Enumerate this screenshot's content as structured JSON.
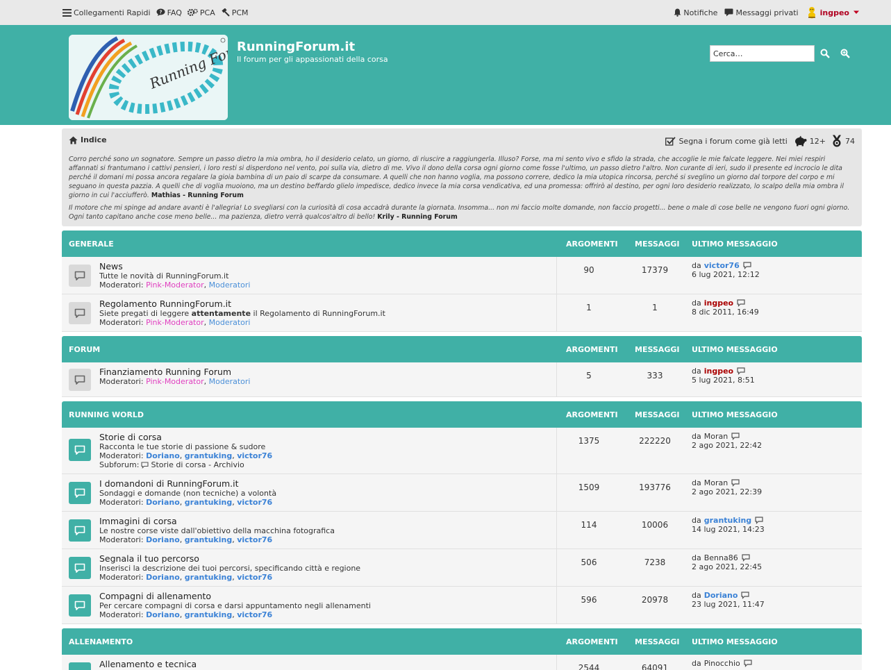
{
  "topbar": {
    "quick_links": "Collegamenti Rapidi",
    "faq": "FAQ",
    "pca": "PCA",
    "pcm": "PCM",
    "notifications": "Notifiche",
    "messages": "Messaggi privati",
    "username": "ingpeo"
  },
  "header": {
    "site_title": "RunningForum.it",
    "site_desc": "Il forum per gli appassionati della corsa",
    "search_placeholder": "Cerca…"
  },
  "navbar": {
    "crumb": "Indice",
    "mark_read": "Segna i forum come già letti",
    "online_count": "12+",
    "medal_count": "74",
    "quote1_text": "Corro perché sono un sognatore. Sempre un passo dietro la mia ombra, ho il desiderio celato, un giorno, di riuscire a raggiungerla. Illuso? Forse, ma mi sento vivo e sfido la strada, che accoglie le mie falcate leggere. Nei miei respiri affannati si frantumano i cattivi pensieri, i loro resti si disperdono nel vento, poi sulla via, dietro di me. Vivo il dono della corsa ogni giorno come fosse l'ultimo, un passo dietro l'altro. Non curante di ieri, sudo il presente ed incrocio le dita perché il domani mi possa ancora regalare la gioia bambina di un paio di scarpe da consumare. A quelli che non hanno voglia, ma possono correre, dedico la mia utopica rincorsa, perché si sveglino un giorno dal torpore del corpo e mi seguano in questa pazzia. A quelli che di voglia muoiono, ma un destino beffardo glielo impedisce, dedico invece la mia corsa vendicativa, ed una promessa: offrirò al destino, per ogni loro desiderio realizzato, lo scalpo della mia ombra il giorno in cui l'acciufferò.",
    "quote1_author": "Mathias - Running Forum",
    "quote2_text": "Il motore che mi spinge ad andare avanti è l'allegria! Lo svegliarsi con la curiosità di cosa accadrà durante la giornata. Insomma... non mi faccio molte domande, non faccio progetti... bene o male di cose belle ne vengono fuori ogni giorno. Ogni tanto capitano anche cose meno belle... ma pazienza, dietro verrà qualcos'altro di bello!",
    "quote2_author": "Krily - Running Forum"
  },
  "columns": {
    "topics": "ARGOMENTI",
    "posts": "MESSAGGI",
    "last_post": "ULTIMO MESSAGGIO"
  },
  "labels": {
    "moderators": "Moderatori:",
    "by": "da",
    "subforum": "Subforum:"
  },
  "categories": [
    {
      "name": "GENERALE",
      "forums": [
        {
          "title": "News",
          "desc": "Tutte le novità di RunningForum.it",
          "mods": [
            "Pink-Moderator",
            "Moderatori"
          ],
          "topics": "90",
          "posts": "17379",
          "last_user": "victor76",
          "last_date": "6 lug 2021, 12:12"
        },
        {
          "title": "Regolamento RunningForum.it",
          "desc_pre": "Siete pregati di leggere ",
          "desc_bold": "attentamente",
          "desc_post": " il Regolamento di RunningForum.it",
          "mods": [
            "Pink-Moderator",
            "Moderatori"
          ],
          "topics": "1",
          "posts": "1",
          "last_user": "ingpeo",
          "last_date": "8 dic 2011, 16:49"
        }
      ]
    },
    {
      "name": "FORUM",
      "forums": [
        {
          "title": "Finanziamento Running Forum",
          "mods": [
            "Pink-Moderator",
            "Moderatori"
          ],
          "topics": "5",
          "posts": "333",
          "last_user": "ingpeo",
          "last_date": "5 lug 2021, 8:51"
        }
      ]
    },
    {
      "name": "RUNNING WORLD",
      "forums": [
        {
          "title": "Storie di corsa",
          "desc": "Racconta le tue storie di passione & sudore",
          "mods": [
            "Doriano",
            "grantuking",
            "victor76"
          ],
          "subforum": "Storie di corsa - Archivio",
          "topics": "1375",
          "posts": "222220",
          "last_user": "Moran",
          "last_date": "2 ago 2021, 22:42"
        },
        {
          "title": "I domandoni di RunningForum.it",
          "desc": "Sondaggi e domande (non tecniche) a volontà",
          "mods": [
            "Doriano",
            "grantuking",
            "victor76"
          ],
          "topics": "1509",
          "posts": "193776",
          "last_user": "Moran",
          "last_date": "2 ago 2021, 22:39"
        },
        {
          "title": "Immagini di corsa",
          "desc": "Le nostre corse viste dall'obiettivo della macchina fotografica",
          "mods": [
            "Doriano",
            "grantuking",
            "victor76"
          ],
          "topics": "114",
          "posts": "10006",
          "last_user": "grantuking",
          "last_date": "14 lug 2021, 14:23"
        },
        {
          "title": "Segnala il tuo percorso",
          "desc": "Inserisci la descrizione dei tuoi percorsi, specificando città e regione",
          "mods": [
            "Doriano",
            "grantuking",
            "victor76"
          ],
          "topics": "506",
          "posts": "7238",
          "last_user": "Benna86",
          "last_date": "2 ago 2021, 22:45"
        },
        {
          "title": "Compagni di allenamento",
          "desc": "Per cercare compagni di corsa e darsi appuntamento negli allenamenti",
          "mods": [
            "Doriano",
            "grantuking",
            "victor76"
          ],
          "topics": "596",
          "posts": "20978",
          "last_user": "Doriano",
          "last_date": "23 lug 2021, 11:47"
        }
      ]
    },
    {
      "name": "ALLENAMENTO",
      "forums": [
        {
          "title": "Allenamento e tecnica",
          "topics": "2544",
          "posts": "64091",
          "last_user": "Pinocchio"
        }
      ]
    }
  ],
  "colors": {
    "accent": "#40b0a6",
    "user_red": "#aa0000",
    "link_blue": "#3b82d6",
    "mod_pink": "#e040c0"
  }
}
